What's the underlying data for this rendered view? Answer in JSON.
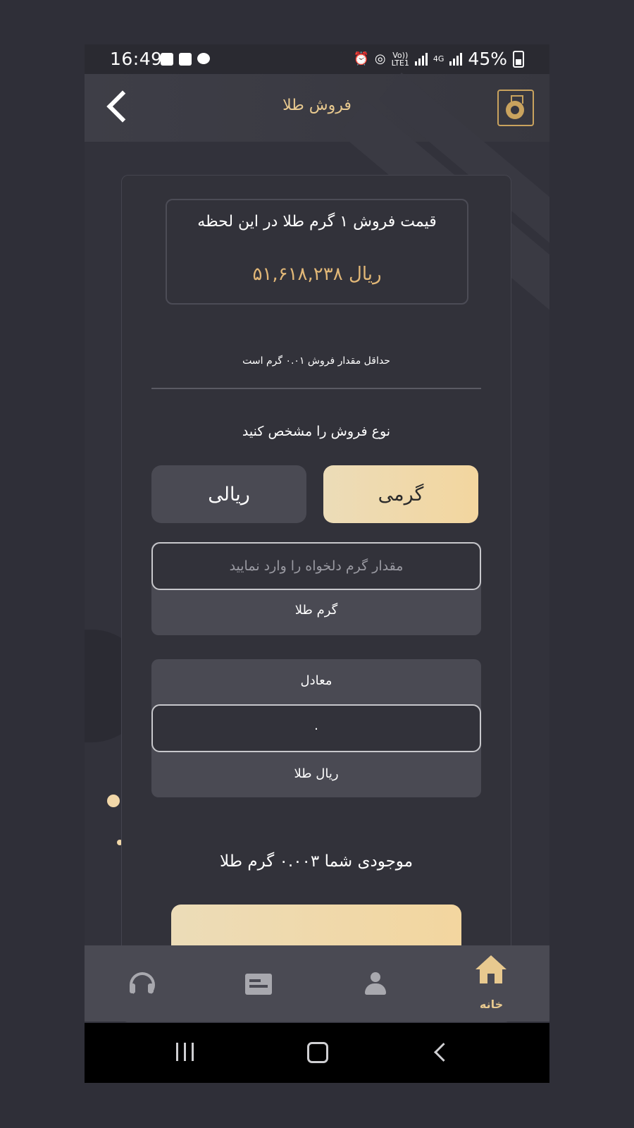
{
  "status_bar": {
    "time": "16:49",
    "battery": "45%",
    "volte": "Vo))",
    "lte": "LTE1",
    "net": "4G"
  },
  "header": {
    "title": "فروش طلا"
  },
  "price_box": {
    "title": "قیمت فروش ۱ گرم طلا در این لحظه",
    "value": "۵۱,۶۱۸,۲۳۸ ریال"
  },
  "min_note": "حداقل مقدار فروش ۰.۰۱ گرم است",
  "sale_type": {
    "label": "نوع فروش را مشخص کنید",
    "gram_label": "گرمی",
    "rial_label": "ریالی",
    "selected": "گرمی"
  },
  "gram_input": {
    "placeholder": "مقدار گرم دلخواه را وارد نمایید",
    "value": "",
    "unit": "گرم طلا"
  },
  "equivalent": {
    "label": "معادل",
    "value": "۰",
    "unit": "ریال طلا"
  },
  "balance": "موجودی شما ۰.۰۰۳ گرم طلا",
  "bottom_nav": {
    "home_label": "خانه"
  },
  "colors": {
    "accent": "#e8c98f",
    "price": "#e1b777",
    "background": "#32323b",
    "panel": "#4a4a53"
  }
}
